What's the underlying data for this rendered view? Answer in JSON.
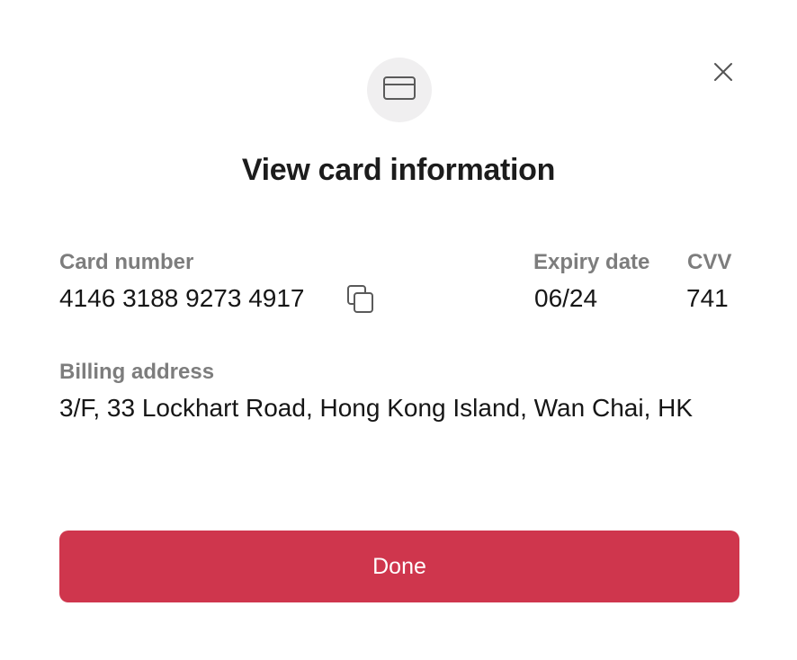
{
  "dialog": {
    "title": "View card information",
    "icons": {
      "header": "credit-card-icon",
      "close": "close-icon",
      "copy": "copy-icon"
    }
  },
  "card": {
    "number_label": "Card number",
    "number_value": "4146 3188 9273 4917",
    "expiry_label": "Expiry date",
    "expiry_value": "06/24",
    "cvv_label": "CVV",
    "cvv_value": "741"
  },
  "billing": {
    "label": "Billing address",
    "value": "3/F, 33 Lockhart Road, Hong Kong Island, Wan Chai, HK"
  },
  "actions": {
    "done_label": "Done"
  },
  "colors": {
    "accent": "#cf364d",
    "label_gray": "#7d7d7d",
    "text_dark": "#161616",
    "badge_bg": "#f0eff0"
  }
}
